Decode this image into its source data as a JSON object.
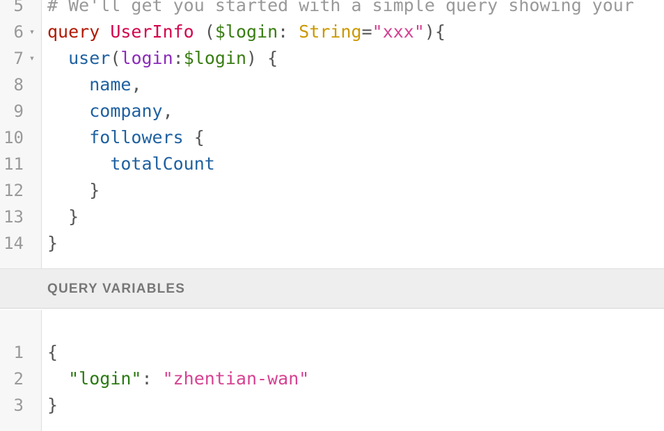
{
  "query_editor": {
    "lines": [
      {
        "num": "5",
        "fold": "",
        "indent": "",
        "tokens": [
          {
            "t": "# We'll get you started with a simple query showing your",
            "c": "tok-comment"
          }
        ]
      },
      {
        "num": "6",
        "fold": "▾",
        "indent": "",
        "tokens": [
          {
            "t": "query",
            "c": "tok-keyword"
          },
          {
            "t": " ",
            "c": "tok-punct"
          },
          {
            "t": "UserInfo",
            "c": "tok-def"
          },
          {
            "t": " (",
            "c": "tok-punct"
          },
          {
            "t": "$login",
            "c": "tok-variable"
          },
          {
            "t": ": ",
            "c": "tok-punct"
          },
          {
            "t": "String",
            "c": "tok-type"
          },
          {
            "t": "=",
            "c": "tok-punct"
          },
          {
            "t": "\"xxx\"",
            "c": "tok-string"
          },
          {
            "t": "){",
            "c": "tok-punct"
          }
        ]
      },
      {
        "num": "7",
        "fold": "▾",
        "indent": "  ",
        "tokens": [
          {
            "t": "user",
            "c": "tok-property"
          },
          {
            "t": "(",
            "c": "tok-punct"
          },
          {
            "t": "login",
            "c": "tok-attribute"
          },
          {
            "t": ":",
            "c": "tok-punct"
          },
          {
            "t": "$login",
            "c": "tok-variable"
          },
          {
            "t": ") {",
            "c": "tok-punct"
          }
        ]
      },
      {
        "num": "8",
        "fold": "",
        "indent": "    ",
        "tokens": [
          {
            "t": "name",
            "c": "tok-property"
          },
          {
            "t": ",",
            "c": "tok-punct"
          }
        ]
      },
      {
        "num": "9",
        "fold": "",
        "indent": "    ",
        "tokens": [
          {
            "t": "company",
            "c": "tok-property"
          },
          {
            "t": ",",
            "c": "tok-punct"
          }
        ]
      },
      {
        "num": "10",
        "fold": "",
        "indent": "    ",
        "tokens": [
          {
            "t": "followers",
            "c": "tok-property"
          },
          {
            "t": " {",
            "c": "tok-punct"
          }
        ]
      },
      {
        "num": "11",
        "fold": "",
        "indent": "      ",
        "tokens": [
          {
            "t": "totalCount",
            "c": "tok-property"
          }
        ]
      },
      {
        "num": "12",
        "fold": "",
        "indent": "    ",
        "tokens": [
          {
            "t": "}",
            "c": "tok-punct"
          }
        ]
      },
      {
        "num": "13",
        "fold": "",
        "indent": "  ",
        "tokens": [
          {
            "t": "}",
            "c": "tok-punct"
          }
        ]
      },
      {
        "num": "14",
        "fold": "",
        "indent": "",
        "tokens": [
          {
            "t": "}",
            "c": "tok-punct"
          }
        ]
      }
    ]
  },
  "variables_panel": {
    "title": "QUERY VARIABLES"
  },
  "variables_editor": {
    "lines": [
      {
        "num": "1",
        "fold": "",
        "indent": "",
        "tokens": [
          {
            "t": "{",
            "c": "tok-punct"
          }
        ]
      },
      {
        "num": "2",
        "fold": "",
        "indent": "  ",
        "tokens": [
          {
            "t": "\"login\"",
            "c": "tok-jsonkey"
          },
          {
            "t": ": ",
            "c": "tok-punct"
          },
          {
            "t": "\"zhentian-wan\"",
            "c": "tok-string"
          }
        ]
      },
      {
        "num": "3",
        "fold": "",
        "indent": "",
        "tokens": [
          {
            "t": "}",
            "c": "tok-punct"
          }
        ]
      }
    ]
  },
  "colors": {
    "keyword": "#b11a04",
    "def": "#d2054e",
    "variable": "#397d13",
    "type": "#ca9800",
    "string": "#d64292",
    "property": "#1f61a0",
    "attribute": "#8b2bb9",
    "comment": "#999999"
  }
}
